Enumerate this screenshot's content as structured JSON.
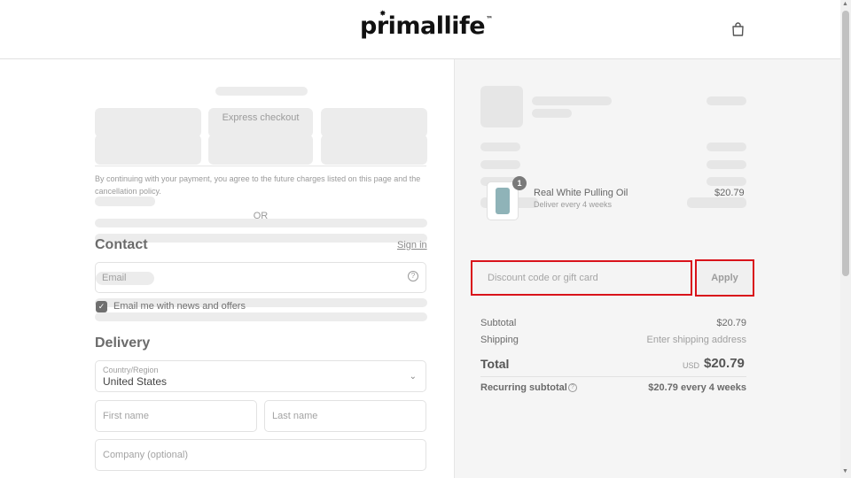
{
  "header": {
    "logo_text": "primallife",
    "logo_tm": "™",
    "cart_icon": "shopping-bag-icon"
  },
  "checkout": {
    "express_label": "Express checkout",
    "legal_text": "By continuing with your payment, you agree to the future charges listed on this page and the cancellation policy.",
    "or_label": "OR"
  },
  "contact": {
    "heading": "Contact",
    "signin_label": "Sign in",
    "email_placeholder": "Email",
    "newsletter_label": "Email me with news and offers",
    "newsletter_checked": true
  },
  "delivery": {
    "heading": "Delivery",
    "country_label": "Country/Region",
    "country_value": "United States",
    "first_name_placeholder": "First name",
    "last_name_placeholder": "Last name",
    "company_placeholder": "Company (optional)"
  },
  "order": {
    "item_qty": "1",
    "item_name": "Real White Pulling Oil",
    "item_subtext": "Deliver every 4 weeks",
    "item_price": "$20.79",
    "discount_placeholder": "Discount code or gift card",
    "apply_label": "Apply",
    "subtotal_label": "Subtotal",
    "subtotal_value": "$20.79",
    "shipping_label": "Shipping",
    "shipping_value": "Enter shipping address",
    "total_label": "Total",
    "total_currency": "USD",
    "total_value": "$20.79",
    "recurring_label": "Recurring subtotal",
    "recurring_value": "$20.79 every 4 weeks"
  },
  "colors": {
    "highlight": "#d9131b",
    "panel_bg": "#f5f5f5"
  }
}
